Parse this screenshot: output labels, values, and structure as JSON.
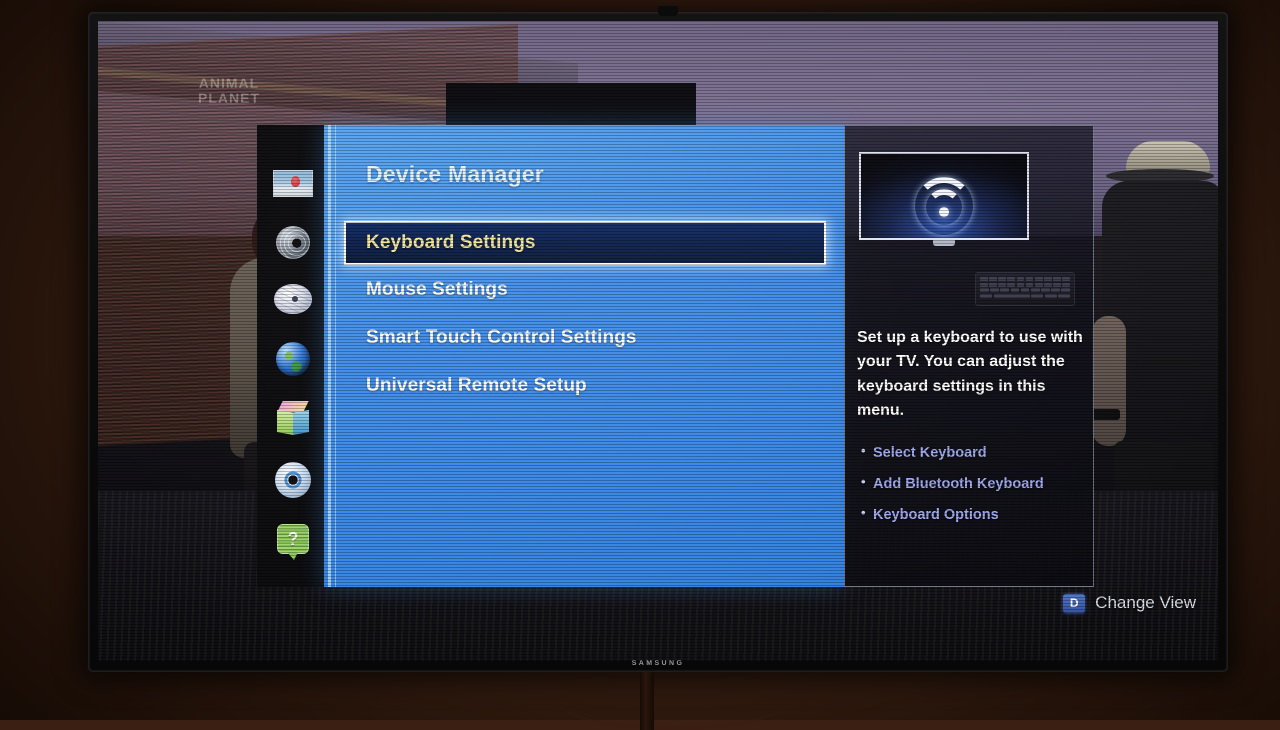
{
  "device": {
    "brand_label": "SAMSUNG"
  },
  "background": {
    "watermark_line1": "ANIMAL",
    "watermark_line2": "PLANET"
  },
  "sidebar": {
    "items": [
      {
        "icon": "picture-icon",
        "name": "sidebar-item-picture"
      },
      {
        "icon": "sound-icon",
        "name": "sidebar-item-sound"
      },
      {
        "icon": "broadcast-icon",
        "name": "sidebar-item-broadcast"
      },
      {
        "icon": "network-icon",
        "name": "sidebar-item-network"
      },
      {
        "icon": "smart-features-icon",
        "name": "sidebar-item-smart-features"
      },
      {
        "icon": "system-gear-icon",
        "name": "sidebar-item-system"
      },
      {
        "icon": "support-help-icon",
        "name": "sidebar-item-support"
      }
    ]
  },
  "menu": {
    "title": "Device Manager",
    "items": [
      {
        "label": "Keyboard Settings",
        "selected": true
      },
      {
        "label": "Mouse Settings",
        "selected": false
      },
      {
        "label": "Smart Touch Control Settings",
        "selected": false
      },
      {
        "label": "Universal Remote Setup",
        "selected": false
      }
    ]
  },
  "info": {
    "thumb_icon": "wifi-icon",
    "keyboard_icon": "keyboard-icon",
    "description": "Set up a keyboard to use with your TV. You can adjust the keyboard settings in this menu.",
    "bullets": [
      "Select Keyboard",
      "Add Bluetooth Keyboard",
      "Keyboard Options"
    ]
  },
  "footer": {
    "key": "D",
    "label": "Change View"
  },
  "colors": {
    "panel_blue": "#3f8ce8",
    "selected_bg": "#0a1f4d",
    "selected_text": "#f4e49a",
    "bullet_text": "#9fa8ef",
    "accent_badge": "#2f4f9e"
  }
}
